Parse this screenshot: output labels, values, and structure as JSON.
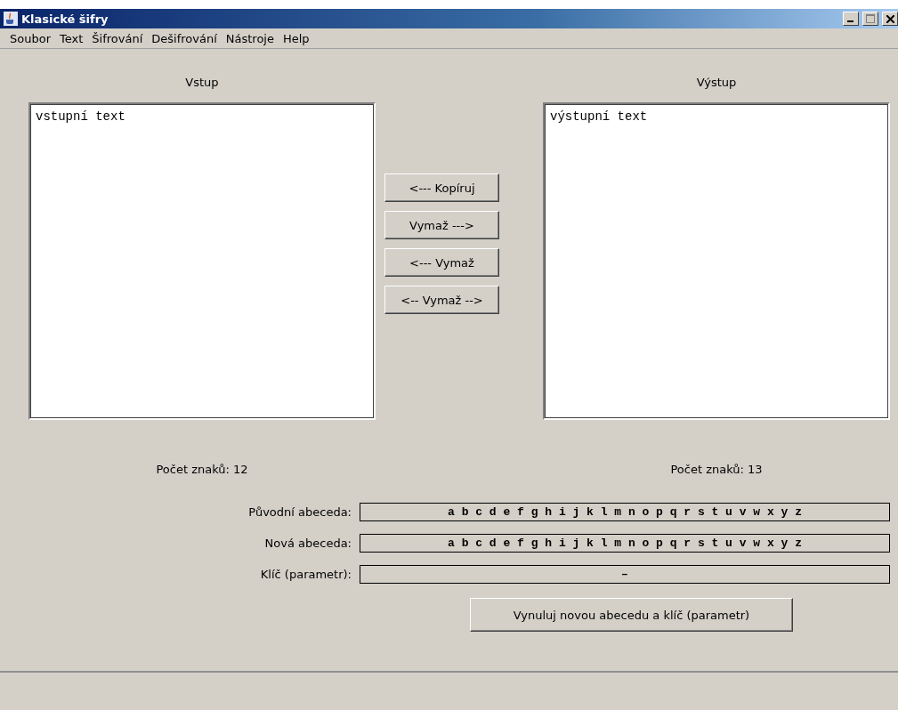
{
  "window": {
    "title": "Klasické šifry"
  },
  "menu": [
    "Soubor",
    "Text",
    "Šifrování",
    "Dešifrování",
    "Nástroje",
    "Help"
  ],
  "input": {
    "label": "Vstup",
    "value": "vstupní text",
    "count": "Počet znaků: 12"
  },
  "output": {
    "label": "Výstup",
    "value": "výstupní text",
    "count": "Počet znaků: 13"
  },
  "buttons": [
    "<--- Kopíruj",
    "Vymaž --->",
    "<--- Vymaž",
    "<-- Vymaž -->"
  ],
  "fields": [
    {
      "label": "Původní abeceda:",
      "value": "a b c d e f g h i j k l m n o p q r s t u v w x y z"
    },
    {
      "label": "Nová abeceda:",
      "value": "a b c d e f g h i j k l m n o p q r s t u v w x y z"
    },
    {
      "label": "Klíč (parametr):",
      "value": "–"
    }
  ],
  "reset_button": "Vynuluj novou abecedu a klíč (parametr)"
}
